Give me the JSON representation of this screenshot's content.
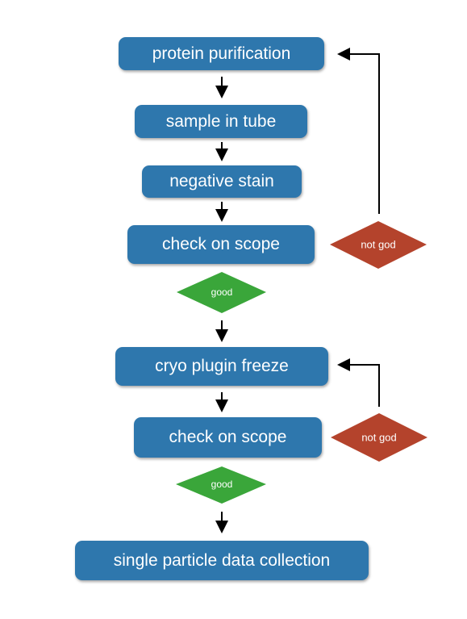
{
  "nodes": {
    "protein_purification": "protein purification",
    "sample_in_tube": "sample in tube",
    "negative_stain": "negative stain",
    "check_on_scope_1": "check on scope",
    "cryo_plugin_freeze": "cryo plugin freeze",
    "check_on_scope_2": "check on scope",
    "single_particle": "single particle data collection"
  },
  "decisions": {
    "good_1": "good",
    "not_god_1": "not god",
    "good_2": "good",
    "not_god_2": "not god"
  },
  "colors": {
    "process": "#2e77ad",
    "good": "#3aa63a",
    "bad": "#b4432c"
  }
}
